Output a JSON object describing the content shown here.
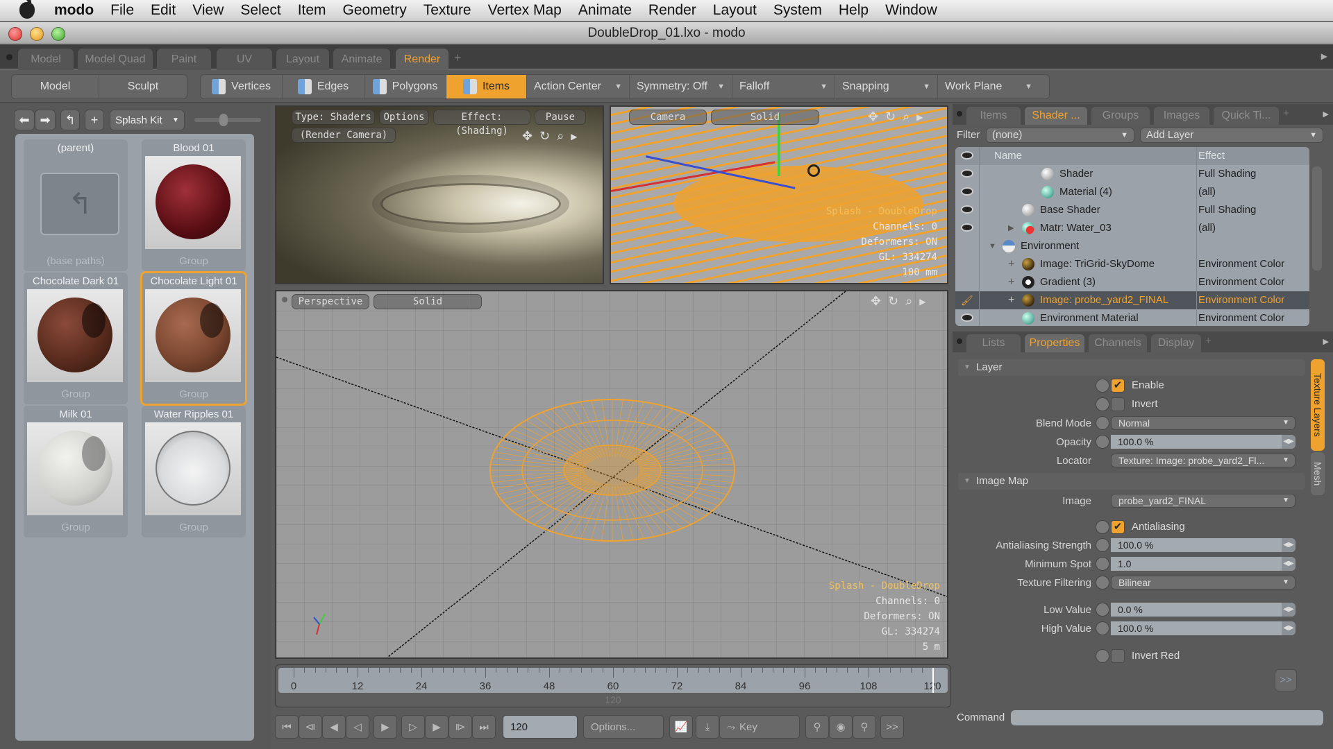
{
  "menubar": {
    "app": "modo",
    "items": [
      "File",
      "Edit",
      "View",
      "Select",
      "Item",
      "Geometry",
      "Texture",
      "Vertex Map",
      "Animate",
      "Render",
      "Layout",
      "System",
      "Help",
      "Window"
    ]
  },
  "window": {
    "title": "DoubleDrop_01.lxo - modo"
  },
  "layout_tabs": [
    {
      "label": "Model",
      "active": false
    },
    {
      "label": "Model Quad",
      "active": false
    },
    {
      "label": "Paint",
      "active": false
    },
    {
      "label": "UV",
      "active": false
    },
    {
      "label": "Layout",
      "active": false
    },
    {
      "label": "Animate",
      "active": false
    },
    {
      "label": "Render",
      "active": true
    }
  ],
  "layout_tabs_add": "+",
  "toolbar": {
    "mode_buttons": [
      "Model",
      "Sculpt"
    ],
    "selection_modes": [
      {
        "label": "Vertices",
        "active": false
      },
      {
        "label": "Edges",
        "active": false
      },
      {
        "label": "Polygons",
        "active": false
      },
      {
        "label": "Items",
        "active": true
      }
    ],
    "dropdowns": [
      "Action Center",
      "Symmetry: Off",
      "Falloff",
      "Snapping",
      "Work Plane"
    ]
  },
  "preset_browser": {
    "kit": "Splash Kit",
    "items": [
      {
        "name": "(parent)",
        "sub": "(base paths)",
        "type": "folder",
        "selected": false
      },
      {
        "name": "Blood 01",
        "sub": "Group",
        "color": "#6a1418",
        "selected": false
      },
      {
        "name": "Chocolate Dark 01",
        "sub": "Group",
        "color": "#5a2c1e",
        "selected": false
      },
      {
        "name": "Chocolate Light 01",
        "sub": "Group",
        "color": "#7a4630",
        "selected": true
      },
      {
        "name": "Milk 01",
        "sub": "Group",
        "color": "#d8d8d4",
        "selected": false
      },
      {
        "name": "Water Ripples 01",
        "sub": "Group",
        "color": "#e0e2e4",
        "selected": false
      }
    ]
  },
  "render_viewport": {
    "type": "Type: Shaders",
    "options": "Options",
    "effect": "Effect: (Shading)",
    "pause": "Pause",
    "camera": "(Render Camera)"
  },
  "camera_viewport": {
    "view": "Camera",
    "shading": "Solid",
    "hud": [
      "Splash - DoubleDrop",
      "Channels: 0",
      "Deformers: ON",
      "GL: 334274",
      "100 mm"
    ]
  },
  "perspective_viewport": {
    "view": "Perspective",
    "shading": "Solid",
    "hud": [
      "Splash - DoubleDrop",
      "Channels: 0",
      "Deformers: ON",
      "GL: 334274",
      "5 m"
    ]
  },
  "shader_panel": {
    "tabs": [
      {
        "label": "Items",
        "active": false
      },
      {
        "label": "Shader ...",
        "active": true
      },
      {
        "label": "Groups",
        "active": false
      },
      {
        "label": "Images",
        "active": false
      },
      {
        "label": "Quick Ti...",
        "active": false
      }
    ],
    "filter_label": "Filter",
    "filter_value": "(none)",
    "add_layer": "Add Layer",
    "columns": [
      "Name",
      "Effect"
    ],
    "rows": [
      {
        "name": "Shader",
        "effect": "Full Shading",
        "indent": 3,
        "icon": "white",
        "eye": true,
        "expander": "",
        "selected": false
      },
      {
        "name": "Material (4)",
        "effect": "(all)",
        "indent": 3,
        "icon": "green",
        "eye": true,
        "expander": "",
        "selected": false
      },
      {
        "name": "Base Shader",
        "effect": "Full Shading",
        "indent": 2,
        "icon": "white",
        "eye": true,
        "expander": "",
        "selected": false
      },
      {
        "name": "Matr: Water_03",
        "effect": "(all)",
        "indent": 2,
        "icon": "mixed",
        "eye": true,
        "expander": "▶",
        "selected": false
      },
      {
        "name": "Environment",
        "effect": "",
        "indent": 1,
        "icon": "sky",
        "eye": false,
        "expander": "▼",
        "selected": false
      },
      {
        "name": "Image: TriGrid-SkyDome",
        "effect": "Environment Color",
        "indent": 2,
        "icon": "image",
        "eye": false,
        "expander": "+",
        "selected": false
      },
      {
        "name": "Gradient (3)",
        "effect": "Environment Color",
        "indent": 2,
        "icon": "gradient",
        "eye": false,
        "expander": "+",
        "selected": false
      },
      {
        "name": "Image: probe_yard2_FINAL",
        "effect": "Environment Color",
        "indent": 2,
        "icon": "image",
        "eye": false,
        "brush": true,
        "expander": "+",
        "selected": true
      },
      {
        "name": "Environment Material",
        "effect": "Environment Color",
        "indent": 2,
        "icon": "green",
        "eye": true,
        "expander": "",
        "selected": false
      }
    ]
  },
  "properties_panel": {
    "tabs": [
      {
        "label": "Lists",
        "active": false
      },
      {
        "label": "Properties",
        "active": true
      },
      {
        "label": "Channels",
        "active": false
      },
      {
        "label": "Display",
        "active": false
      }
    ],
    "side_tabs": [
      {
        "label": "Texture Layers",
        "active": true
      },
      {
        "label": "Mesh",
        "active": false
      }
    ],
    "layer_section": "Layer",
    "enable": {
      "label": "Enable",
      "checked": true
    },
    "invert": {
      "label": "Invert",
      "checked": false
    },
    "blend_mode": {
      "label": "Blend Mode",
      "value": "Normal"
    },
    "opacity": {
      "label": "Opacity",
      "value": "100.0 %"
    },
    "locator": {
      "label": "Locator",
      "value": "Texture: Image: probe_yard2_Fl..."
    },
    "image_map_section": "Image Map",
    "image": {
      "label": "Image",
      "value": "probe_yard2_FINAL"
    },
    "antialiasing": {
      "label": "Antialiasing",
      "checked": true
    },
    "aa_strength": {
      "label": "Antialiasing Strength",
      "value": "100.0 %"
    },
    "min_spot": {
      "label": "Minimum Spot",
      "value": "1.0"
    },
    "texture_filtering": {
      "label": "Texture Filtering",
      "value": "Bilinear"
    },
    "low_value": {
      "label": "Low Value",
      "value": "0.0 %"
    },
    "high_value": {
      "label": "High Value",
      "value": "100.0 %"
    },
    "invert_red": {
      "label": "Invert Red",
      "checked": false
    },
    "more": ">>"
  },
  "command": {
    "label": "Command",
    "value": ""
  },
  "timeline": {
    "ticks": [
      "0",
      "12",
      "24",
      "36",
      "48",
      "60",
      "72",
      "84",
      "96",
      "108",
      "120"
    ],
    "range_end": "120",
    "current_frame": "120"
  },
  "transport": {
    "frame": "120",
    "options": "Options...",
    "key": "Key",
    "more": ">>"
  },
  "colors": {
    "accent": "#f0a22e",
    "panel": "#5a5a5a",
    "list_bg": "#9ba2a9"
  }
}
